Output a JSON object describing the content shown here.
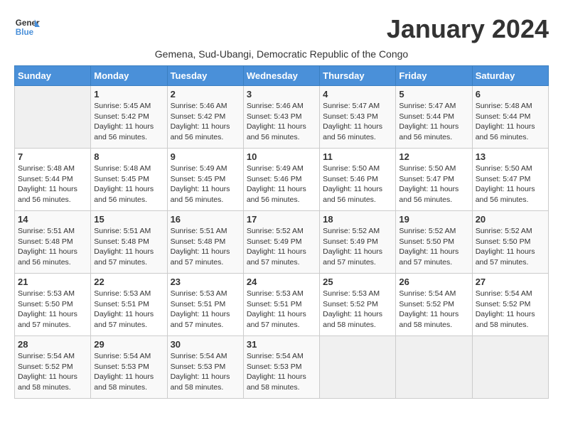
{
  "logo": {
    "line1": "General",
    "line2": "Blue"
  },
  "title": "January 2024",
  "subtitle": "Gemena, Sud-Ubangi, Democratic Republic of the Congo",
  "headers": [
    "Sunday",
    "Monday",
    "Tuesday",
    "Wednesday",
    "Thursday",
    "Friday",
    "Saturday"
  ],
  "weeks": [
    [
      {
        "day": "",
        "info": ""
      },
      {
        "day": "1",
        "info": "Sunrise: 5:45 AM\nSunset: 5:42 PM\nDaylight: 11 hours\nand 56 minutes."
      },
      {
        "day": "2",
        "info": "Sunrise: 5:46 AM\nSunset: 5:42 PM\nDaylight: 11 hours\nand 56 minutes."
      },
      {
        "day": "3",
        "info": "Sunrise: 5:46 AM\nSunset: 5:43 PM\nDaylight: 11 hours\nand 56 minutes."
      },
      {
        "day": "4",
        "info": "Sunrise: 5:47 AM\nSunset: 5:43 PM\nDaylight: 11 hours\nand 56 minutes."
      },
      {
        "day": "5",
        "info": "Sunrise: 5:47 AM\nSunset: 5:44 PM\nDaylight: 11 hours\nand 56 minutes."
      },
      {
        "day": "6",
        "info": "Sunrise: 5:48 AM\nSunset: 5:44 PM\nDaylight: 11 hours\nand 56 minutes."
      }
    ],
    [
      {
        "day": "7",
        "info": "Sunrise: 5:48 AM\nSunset: 5:44 PM\nDaylight: 11 hours\nand 56 minutes."
      },
      {
        "day": "8",
        "info": "Sunrise: 5:48 AM\nSunset: 5:45 PM\nDaylight: 11 hours\nand 56 minutes."
      },
      {
        "day": "9",
        "info": "Sunrise: 5:49 AM\nSunset: 5:45 PM\nDaylight: 11 hours\nand 56 minutes."
      },
      {
        "day": "10",
        "info": "Sunrise: 5:49 AM\nSunset: 5:46 PM\nDaylight: 11 hours\nand 56 minutes."
      },
      {
        "day": "11",
        "info": "Sunrise: 5:50 AM\nSunset: 5:46 PM\nDaylight: 11 hours\nand 56 minutes."
      },
      {
        "day": "12",
        "info": "Sunrise: 5:50 AM\nSunset: 5:47 PM\nDaylight: 11 hours\nand 56 minutes."
      },
      {
        "day": "13",
        "info": "Sunrise: 5:50 AM\nSunset: 5:47 PM\nDaylight: 11 hours\nand 56 minutes."
      }
    ],
    [
      {
        "day": "14",
        "info": "Sunrise: 5:51 AM\nSunset: 5:48 PM\nDaylight: 11 hours\nand 56 minutes."
      },
      {
        "day": "15",
        "info": "Sunrise: 5:51 AM\nSunset: 5:48 PM\nDaylight: 11 hours\nand 57 minutes."
      },
      {
        "day": "16",
        "info": "Sunrise: 5:51 AM\nSunset: 5:48 PM\nDaylight: 11 hours\nand 57 minutes."
      },
      {
        "day": "17",
        "info": "Sunrise: 5:52 AM\nSunset: 5:49 PM\nDaylight: 11 hours\nand 57 minutes."
      },
      {
        "day": "18",
        "info": "Sunrise: 5:52 AM\nSunset: 5:49 PM\nDaylight: 11 hours\nand 57 minutes."
      },
      {
        "day": "19",
        "info": "Sunrise: 5:52 AM\nSunset: 5:50 PM\nDaylight: 11 hours\nand 57 minutes."
      },
      {
        "day": "20",
        "info": "Sunrise: 5:52 AM\nSunset: 5:50 PM\nDaylight: 11 hours\nand 57 minutes."
      }
    ],
    [
      {
        "day": "21",
        "info": "Sunrise: 5:53 AM\nSunset: 5:50 PM\nDaylight: 11 hours\nand 57 minutes."
      },
      {
        "day": "22",
        "info": "Sunrise: 5:53 AM\nSunset: 5:51 PM\nDaylight: 11 hours\nand 57 minutes."
      },
      {
        "day": "23",
        "info": "Sunrise: 5:53 AM\nSunset: 5:51 PM\nDaylight: 11 hours\nand 57 minutes."
      },
      {
        "day": "24",
        "info": "Sunrise: 5:53 AM\nSunset: 5:51 PM\nDaylight: 11 hours\nand 57 minutes."
      },
      {
        "day": "25",
        "info": "Sunrise: 5:53 AM\nSunset: 5:52 PM\nDaylight: 11 hours\nand 58 minutes."
      },
      {
        "day": "26",
        "info": "Sunrise: 5:54 AM\nSunset: 5:52 PM\nDaylight: 11 hours\nand 58 minutes."
      },
      {
        "day": "27",
        "info": "Sunrise: 5:54 AM\nSunset: 5:52 PM\nDaylight: 11 hours\nand 58 minutes."
      }
    ],
    [
      {
        "day": "28",
        "info": "Sunrise: 5:54 AM\nSunset: 5:52 PM\nDaylight: 11 hours\nand 58 minutes."
      },
      {
        "day": "29",
        "info": "Sunrise: 5:54 AM\nSunset: 5:53 PM\nDaylight: 11 hours\nand 58 minutes."
      },
      {
        "day": "30",
        "info": "Sunrise: 5:54 AM\nSunset: 5:53 PM\nDaylight: 11 hours\nand 58 minutes."
      },
      {
        "day": "31",
        "info": "Sunrise: 5:54 AM\nSunset: 5:53 PM\nDaylight: 11 hours\nand 58 minutes."
      },
      {
        "day": "",
        "info": ""
      },
      {
        "day": "",
        "info": ""
      },
      {
        "day": "",
        "info": ""
      }
    ]
  ]
}
